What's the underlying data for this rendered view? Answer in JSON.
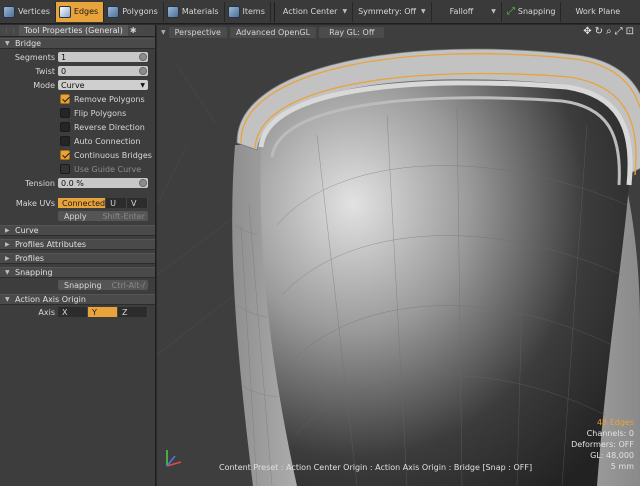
{
  "toolbar": {
    "modes": [
      {
        "label": "Vertices",
        "active": false
      },
      {
        "label": "Edges",
        "active": true
      },
      {
        "label": "Polygons",
        "active": false
      },
      {
        "label": "Materials",
        "active": false
      },
      {
        "label": "Items",
        "active": false
      }
    ],
    "action_center": "Action Center",
    "symmetry": "Symmetry: Off",
    "falloff": "Falloff",
    "snapping": "Snapping",
    "work_plane": "Work Plane"
  },
  "panel": {
    "tab_title": "Tool Properties (General)",
    "sections": {
      "bridge": "Bridge",
      "curve": "Curve",
      "profiles_attributes": "Profiles Attributes",
      "profiles": "Profiles",
      "snapping": "Snapping",
      "action_axis_origin": "Action Axis Origin"
    },
    "segments_label": "Segments",
    "segments_value": "1",
    "twist_label": "Twist",
    "twist_value": "0",
    "mode_label": "Mode",
    "mode_value": "Curve",
    "checks": {
      "remove_polygons": "Remove Polygons",
      "flip_polygons": "Flip Polygons",
      "reverse_direction": "Reverse Direction",
      "auto_connection": "Auto Connection",
      "continuous_bridges": "Continuous Bridges",
      "use_guide_curve": "Use Guide Curve"
    },
    "tension_label": "Tension",
    "tension_value": "0.0 %",
    "make_uvs_label": "Make UVs",
    "make_uvs_options": [
      "Connected",
      "U",
      "V"
    ],
    "apply_label": "Apply",
    "apply_shortcut": "Shift-Enter",
    "snapping_button": "Snapping",
    "snapping_shortcut": "Ctrl-Alt-/",
    "axis_label": "Axis",
    "axis_options": [
      "X",
      "Y",
      "Z"
    ]
  },
  "viewport": {
    "tabs": [
      "Perspective",
      "Advanced OpenGL",
      "Ray GL: Off"
    ],
    "info": {
      "edges": "48 Edges",
      "channels": "Channels: 0",
      "deformers": "Deformers: OFF",
      "gl": "GL: 48,000",
      "scale": "5 mm"
    },
    "status": "Content Preset : Action Center Origin : Action Axis Origin : Bridge  [Snap : OFF]"
  },
  "colors": {
    "accent": "#e8a33a",
    "panel": "#3d3d3d",
    "viewport": "#3e3e3e"
  }
}
